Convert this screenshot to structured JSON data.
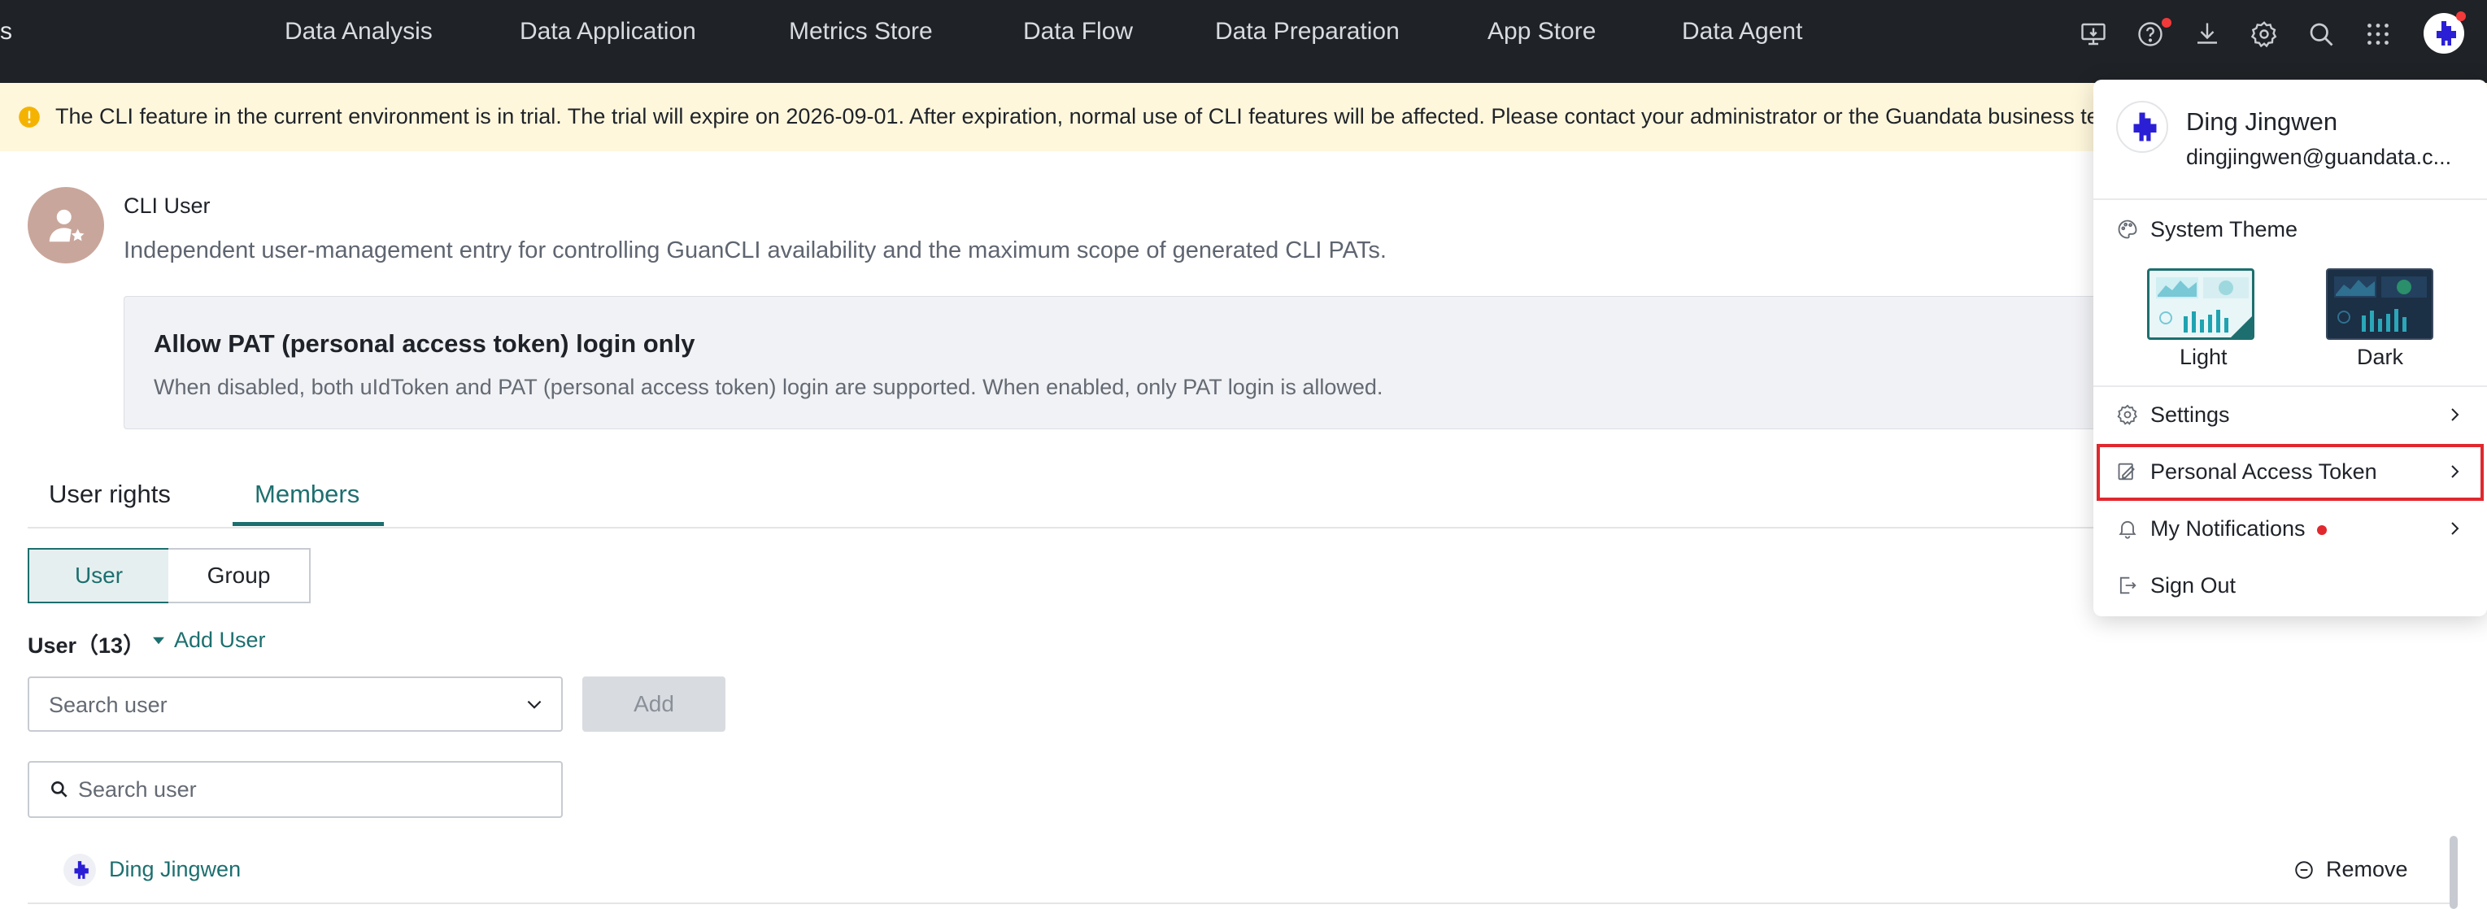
{
  "topbar": {
    "edge_text": "s",
    "nav": [
      "Data Analysis",
      "Data Application",
      "Metrics Store",
      "Data Flow",
      "Data Preparation",
      "App Store",
      "Data Agent"
    ]
  },
  "banner": {
    "text": "The CLI feature in the current environment is in trial. The trial will expire on 2026-09-01. After expiration, normal use of CLI features will be affected. Please contact your administrator or the Guandata business team"
  },
  "cli_user": {
    "title": "CLI User",
    "description": "Independent user-management entry for controlling GuanCLI availability and the maximum scope of generated CLI PATs."
  },
  "pat_option": {
    "title": "Allow PAT (personal access token) login only",
    "description": "When disabled, both uIdToken and PAT (personal access token) login are supported. When enabled, only PAT login is allowed."
  },
  "tabs": {
    "user_rights": "User rights",
    "members": "Members",
    "active": "Members"
  },
  "segment": {
    "user": "User",
    "group": "Group"
  },
  "members": {
    "count_label": "User（13）",
    "add_user": "Add User",
    "select_placeholder": "Search user",
    "add_button": "Add",
    "search_placeholder": "Search user",
    "rows": [
      {
        "name": "Ding Jingwen",
        "action": "Remove"
      }
    ]
  },
  "user_menu": {
    "name": "Ding Jingwen",
    "email": "dingjingwen@guandata.c...",
    "theme_title": "System Theme",
    "themes": {
      "light": "Light",
      "dark": "Dark"
    },
    "selected_theme": "Light",
    "items": {
      "settings": "Settings",
      "pat": "Personal Access Token",
      "notifications": "My Notifications",
      "sign_out": "Sign Out"
    }
  },
  "colors": {
    "accent": "#1d6f6f",
    "topbar": "#1f2226",
    "banner": "#fff7dc",
    "highlight": "#e0282e"
  }
}
